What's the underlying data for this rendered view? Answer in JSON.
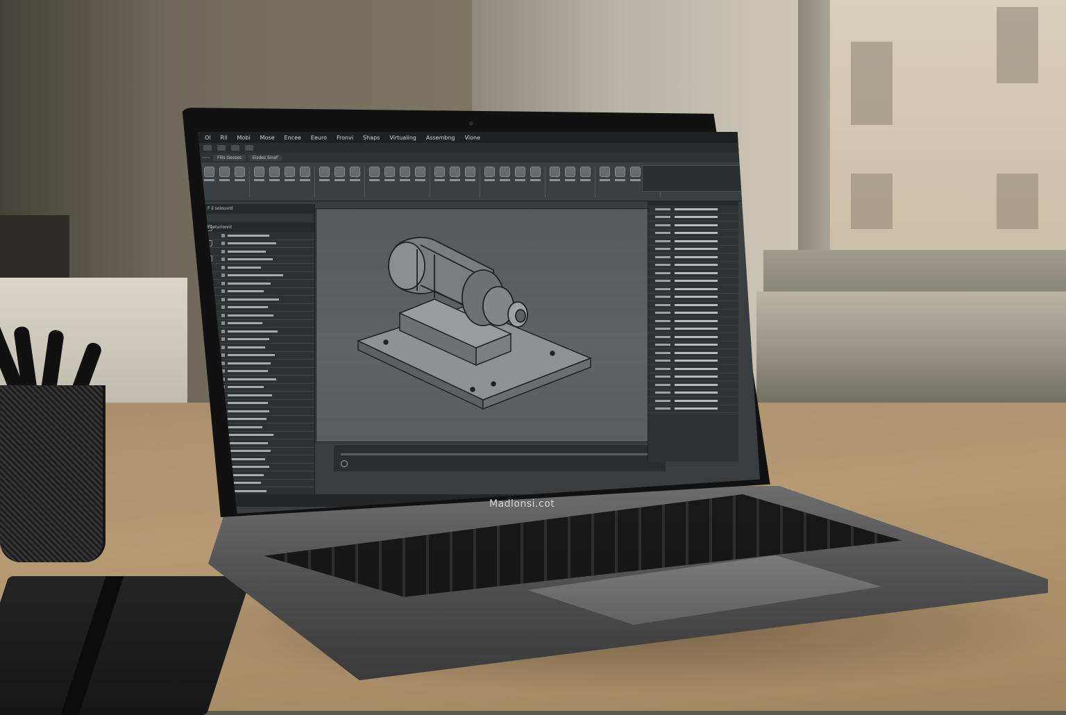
{
  "app": {
    "menu": [
      "Ol",
      "Rll",
      "Mobi",
      "Mose",
      "Encee",
      "Eeuro",
      "Fronvi",
      "Shaps",
      "Virtualing",
      "Assembng",
      "Vione"
    ],
    "ribbon_tabs": [
      "",
      "Flils Gesses",
      "Eisdes Sinaf"
    ],
    "tree_title": "F il solouvrd",
    "tree_subtitle": "Eeeturionnt",
    "brand": "Madlonsi.cot"
  },
  "colors": {
    "screen_bg": "#3a3d3f",
    "viewport_bg": "#5f6365",
    "model_stroke": "#1f2122",
    "model_fill": "#8a8d8f"
  },
  "icons": [
    "play-icon",
    "ribbon-tool-icon"
  ]
}
